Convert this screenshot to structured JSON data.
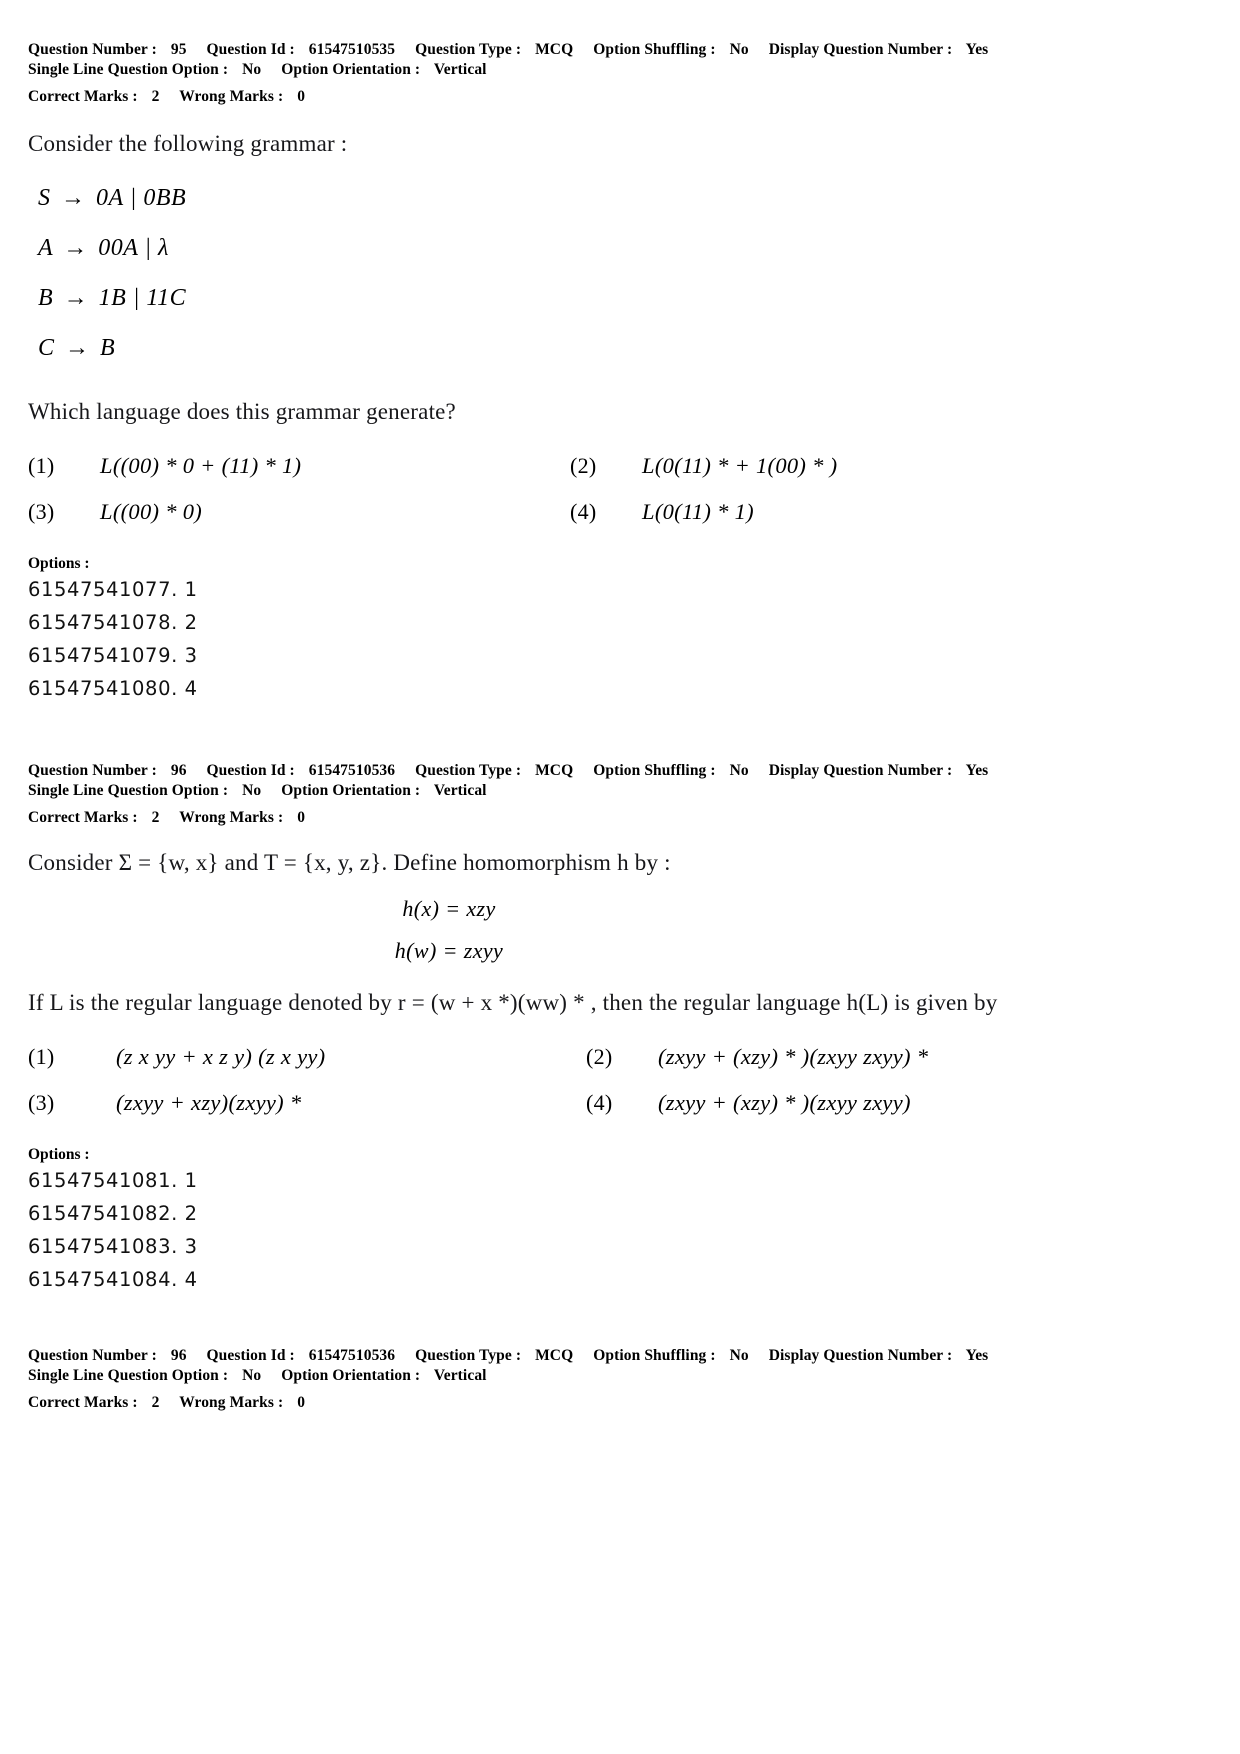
{
  "questions": [
    {
      "meta": {
        "question_number_label": "Question Number :",
        "question_number": "95",
        "question_id_label": "Question Id :",
        "question_id": "61547510535",
        "question_type_label": "Question Type :",
        "question_type": "MCQ",
        "option_shuffling_label": "Option Shuffling :",
        "option_shuffling": "No",
        "display_question_number_label": "Display Question Number :",
        "display_question_number": "Yes",
        "single_line_question_option_label": "Single Line Question Option :",
        "single_line_question_option": "No",
        "option_orientation_label": "Option Orientation :",
        "option_orientation": "Vertical",
        "correct_marks_label": "Correct Marks :",
        "correct_marks": "2",
        "wrong_marks_label": "Wrong Marks :",
        "wrong_marks": "0"
      },
      "stem": "Consider the following grammar :",
      "grammar": [
        {
          "lhs": "S",
          "arrow": "→",
          "rhs": "0A | 0BB"
        },
        {
          "lhs": "A",
          "arrow": "→",
          "rhs": "00A | λ"
        },
        {
          "lhs": "B",
          "arrow": "→",
          "rhs": "1B | 11C"
        },
        {
          "lhs": "C",
          "arrow": "→",
          "rhs": "B"
        }
      ],
      "question_text": "Which language does this grammar generate?",
      "choices": [
        {
          "num": "(1)",
          "text": "L((00) * 0 + (11) * 1)"
        },
        {
          "num": "(2)",
          "text": "L(0(11) * + 1(00) * )"
        },
        {
          "num": "(3)",
          "text": "L((00) * 0)"
        },
        {
          "num": "(4)",
          "text": "L(0(11) * 1)"
        }
      ],
      "options_label": "Options :",
      "option_ids": [
        "61547541077. 1",
        "61547541078. 2",
        "61547541079. 3",
        "61547541080. 4"
      ]
    },
    {
      "meta": {
        "question_number_label": "Question Number :",
        "question_number": "96",
        "question_id_label": "Question Id :",
        "question_id": "61547510536",
        "question_type_label": "Question Type :",
        "question_type": "MCQ",
        "option_shuffling_label": "Option Shuffling :",
        "option_shuffling": "No",
        "display_question_number_label": "Display Question Number :",
        "display_question_number": "Yes",
        "single_line_question_option_label": "Single Line Question Option :",
        "single_line_question_option": "No",
        "option_orientation_label": "Option Orientation :",
        "option_orientation": "Vertical",
        "correct_marks_label": "Correct Marks :",
        "correct_marks": "2",
        "wrong_marks_label": "Wrong Marks :",
        "wrong_marks": "0"
      },
      "stem": "Consider Σ = {w, x} and T = {x, y, z}. Define homomorphism h by :",
      "equations": [
        "h(x) = xzy",
        "h(w) = zxyy"
      ],
      "question_text": "If L is the regular language denoted by r = (w + x *)(ww) * , then the regular language h(L) is given by",
      "choices": [
        {
          "num": "(1)",
          "text": "(z x yy + x z y) (z x yy)"
        },
        {
          "num": "(2)",
          "text": "(zxyy + (xzy) * )(zxyy zxyy) *"
        },
        {
          "num": "(3)",
          "text": "(zxyy + xzy)(zxyy) *"
        },
        {
          "num": "(4)",
          "text": "(zxyy + (xzy) * )(zxyy zxyy)"
        }
      ],
      "options_label": "Options :",
      "option_ids": [
        "61547541081. 1",
        "61547541082. 2",
        "61547541083. 3",
        "61547541084. 4"
      ]
    },
    {
      "meta": {
        "question_number_label": "Question Number :",
        "question_number": "96",
        "question_id_label": "Question Id :",
        "question_id": "61547510536",
        "question_type_label": "Question Type :",
        "question_type": "MCQ",
        "option_shuffling_label": "Option Shuffling :",
        "option_shuffling": "No",
        "display_question_number_label": "Display Question Number :",
        "display_question_number": "Yes",
        "single_line_question_option_label": "Single Line Question Option :",
        "single_line_question_option": "No",
        "option_orientation_label": "Option Orientation :",
        "option_orientation": "Vertical",
        "correct_marks_label": "Correct Marks :",
        "correct_marks": "2",
        "wrong_marks_label": "Wrong Marks :",
        "wrong_marks": "0"
      }
    }
  ]
}
